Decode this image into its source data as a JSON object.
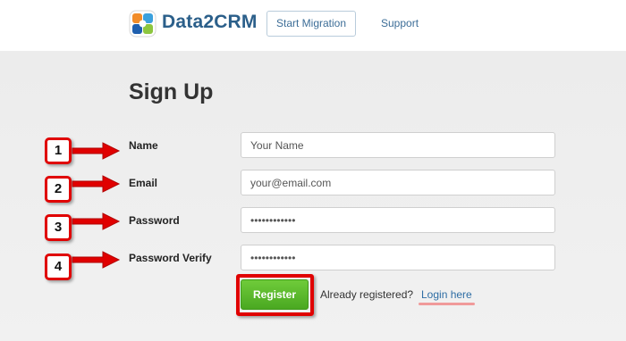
{
  "header": {
    "brand": "Data2CRM",
    "nav": {
      "start_migration": "Start Migration",
      "support": "Support"
    }
  },
  "form": {
    "title": "Sign Up",
    "fields": {
      "name": {
        "label": "Name",
        "placeholder": "Your Name"
      },
      "email": {
        "label": "Email",
        "placeholder": "your@email.com"
      },
      "password": {
        "label": "Password",
        "value": "••••••••••••"
      },
      "password_verify": {
        "label": "Password Verify",
        "value": "••••••••••••"
      }
    },
    "register_label": "Register",
    "already_text": "Already registered?",
    "login_link": "Login here"
  },
  "annotations": {
    "steps": [
      "1",
      "2",
      "3",
      "4"
    ],
    "color": "#e00000"
  },
  "colors": {
    "brand": "#2b5f8a",
    "register": "#5cb82d",
    "link": "#2e6da4"
  }
}
